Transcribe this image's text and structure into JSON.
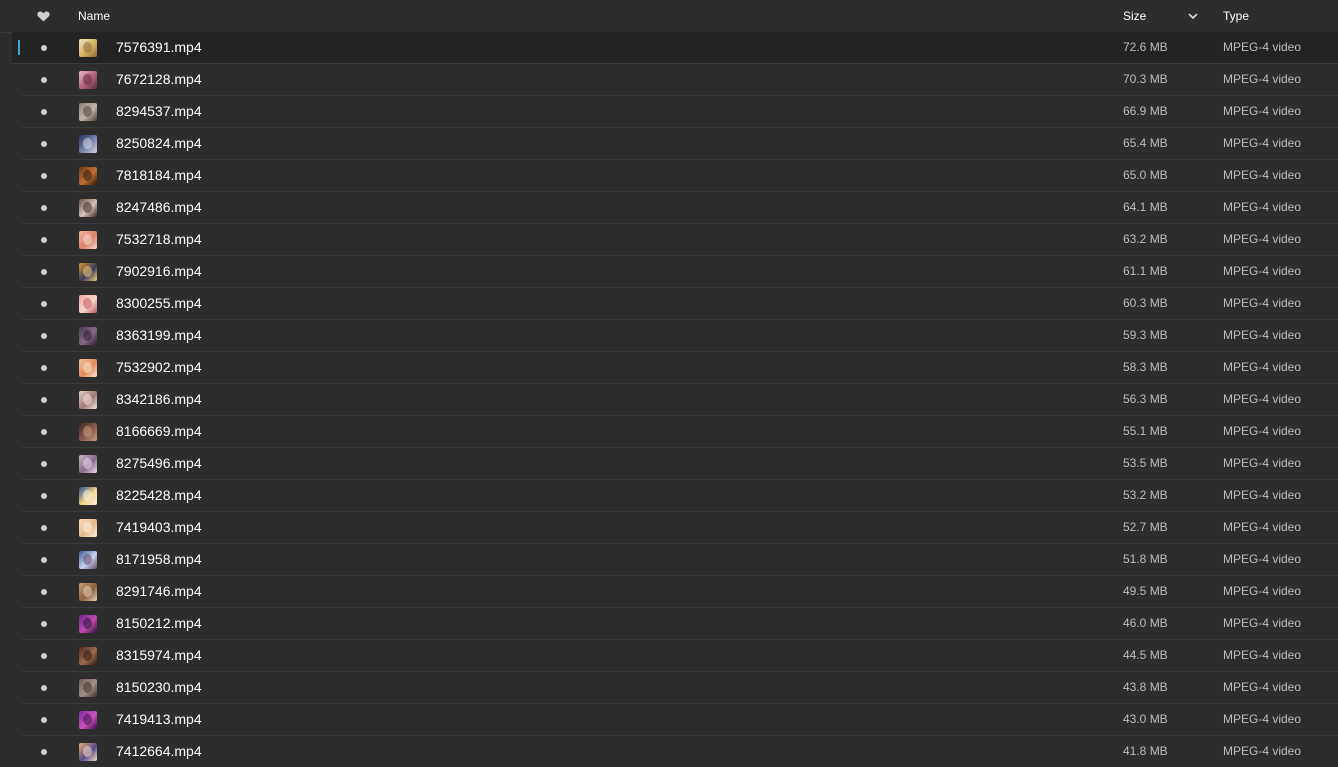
{
  "header": {
    "favorite_icon": "heart-icon",
    "name_label": "Name",
    "size_label": "Size",
    "sort_icon": "chevron-down-icon",
    "type_label": "Type"
  },
  "colors": {
    "background": "#2d2d2d",
    "selected_row": "#232323",
    "focus_accent": "#4aa3d8",
    "text_primary": "#ffffff",
    "text_secondary": "#bdbdbd"
  },
  "files": [
    {
      "name": "7576391.mp4",
      "size": "72.6 MB",
      "type": "MPEG-4 video",
      "thumb": [
        "#f2e3c6",
        "#d6b25a",
        "#8a6a3c"
      ],
      "selected": true
    },
    {
      "name": "7672128.mp4",
      "size": "70.3 MB",
      "type": "MPEG-4 video",
      "thumb": [
        "#e8b6c4",
        "#b0607a",
        "#5a2a3a"
      ]
    },
    {
      "name": "8294537.mp4",
      "size": "66.9 MB",
      "type": "MPEG-4 video",
      "thumb": [
        "#8a7f74",
        "#c2b6a6",
        "#4a4036"
      ]
    },
    {
      "name": "8250824.mp4",
      "size": "65.4 MB",
      "type": "MPEG-4 video",
      "thumb": [
        "#2a3150",
        "#7a86b0",
        "#d8d2e6"
      ]
    },
    {
      "name": "7818184.mp4",
      "size": "65.0 MB",
      "type": "MPEG-4 video",
      "thumb": [
        "#6a3a1e",
        "#c07030",
        "#2e1a10"
      ]
    },
    {
      "name": "8247486.mp4",
      "size": "64.1 MB",
      "type": "MPEG-4 video",
      "thumb": [
        "#6a5048",
        "#d8c4b6",
        "#3a2a26"
      ]
    },
    {
      "name": "7532718.mp4",
      "size": "63.2 MB",
      "type": "MPEG-4 video",
      "thumb": [
        "#f0b8a6",
        "#d9806a",
        "#f6dccf"
      ]
    },
    {
      "name": "7902916.mp4",
      "size": "61.1 MB",
      "type": "MPEG-4 video",
      "thumb": [
        "#d69a2a",
        "#3a3a5a",
        "#f2d07a"
      ]
    },
    {
      "name": "8300255.mp4",
      "size": "60.3 MB",
      "type": "MPEG-4 video",
      "thumb": [
        "#f0a6a6",
        "#f6d6c8",
        "#c05a6a"
      ]
    },
    {
      "name": "8363199.mp4",
      "size": "59.3 MB",
      "type": "MPEG-4 video",
      "thumb": [
        "#4a3a56",
        "#8a6a86",
        "#2a2030"
      ]
    },
    {
      "name": "7532902.mp4",
      "size": "58.3 MB",
      "type": "MPEG-4 video",
      "thumb": [
        "#f2c6a0",
        "#e08a5a",
        "#fae6d2"
      ]
    },
    {
      "name": "8342186.mp4",
      "size": "56.3 MB",
      "type": "MPEG-4 video",
      "thumb": [
        "#e6d0c6",
        "#a07a70",
        "#f4e8e2"
      ]
    },
    {
      "name": "8166669.mp4",
      "size": "55.1 MB",
      "type": "MPEG-4 video",
      "thumb": [
        "#3a2a26",
        "#8a5a4a",
        "#c8a080"
      ]
    },
    {
      "name": "8275496.mp4",
      "size": "53.5 MB",
      "type": "MPEG-4 video",
      "thumb": [
        "#c8b6c6",
        "#8a6a8a",
        "#eadfe8"
      ]
    },
    {
      "name": "8225428.mp4",
      "size": "53.2 MB",
      "type": "MPEG-4 video",
      "thumb": [
        "#2a4a8a",
        "#f6d68a",
        "#f4f0e6"
      ]
    },
    {
      "name": "7419403.mp4",
      "size": "52.7 MB",
      "type": "MPEG-4 video",
      "thumb": [
        "#f6e0c0",
        "#e8b88a",
        "#fbf1e2"
      ]
    },
    {
      "name": "8171958.mp4",
      "size": "51.8 MB",
      "type": "MPEG-4 video",
      "thumb": [
        "#3a5a9a",
        "#c6d2ea",
        "#6a4a6a"
      ]
    },
    {
      "name": "8291746.mp4",
      "size": "49.5 MB",
      "type": "MPEG-4 video",
      "thumb": [
        "#c8a076",
        "#8a6040",
        "#ead2b6"
      ]
    },
    {
      "name": "8150212.mp4",
      "size": "46.0 MB",
      "type": "MPEG-4 video",
      "thumb": [
        "#6a2a8a",
        "#c04ab0",
        "#2a1436"
      ]
    },
    {
      "name": "8315974.mp4",
      "size": "44.5 MB",
      "type": "MPEG-4 video",
      "thumb": [
        "#4a2e22",
        "#a06a4a",
        "#2a1a14"
      ]
    },
    {
      "name": "8150230.mp4",
      "size": "43.8 MB",
      "type": "MPEG-4 video",
      "thumb": [
        "#6a5a56",
        "#a6908a",
        "#3a302e"
      ]
    },
    {
      "name": "7419413.mp4",
      "size": "43.0 MB",
      "type": "MPEG-4 video",
      "thumb": [
        "#7a2a9a",
        "#d050c0",
        "#3a1446"
      ]
    },
    {
      "name": "7412664.mp4",
      "size": "41.8 MB",
      "type": "MPEG-4 video",
      "thumb": [
        "#e6b070",
        "#5a4a8a",
        "#f6e2c6"
      ]
    }
  ]
}
